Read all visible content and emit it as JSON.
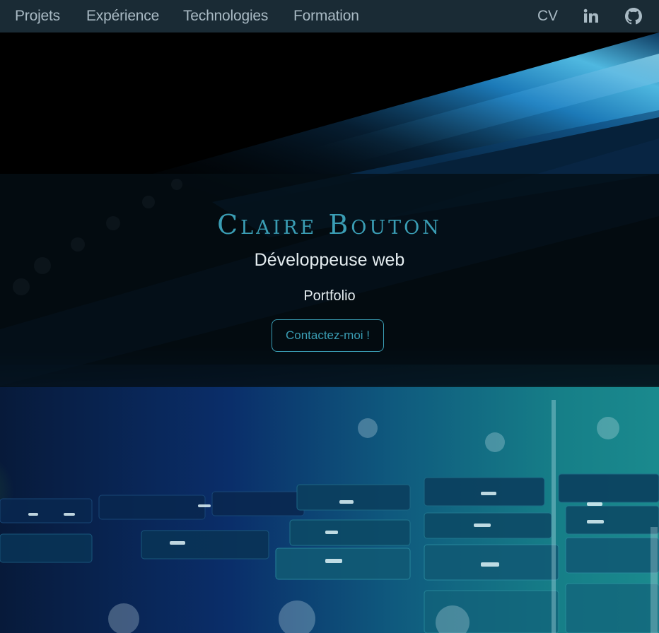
{
  "nav": {
    "links": [
      {
        "label": "Projets"
      },
      {
        "label": "Expérience"
      },
      {
        "label": "Technologies"
      },
      {
        "label": "Formation"
      }
    ],
    "cv_label": "CV",
    "icons": [
      "linkedin-icon",
      "github-icon"
    ]
  },
  "hero": {
    "name": "Claire Bouton",
    "role": "Développeuse web",
    "section": "Portfolio",
    "cta_label": "Contactez-moi !"
  },
  "colors": {
    "navbar_bg": "#1a2b35",
    "nav_text": "#a9bac4",
    "accent": "#3a9db4",
    "overlay": "rgba(4,14,20,0.78)",
    "text_light": "#e4ecef"
  }
}
